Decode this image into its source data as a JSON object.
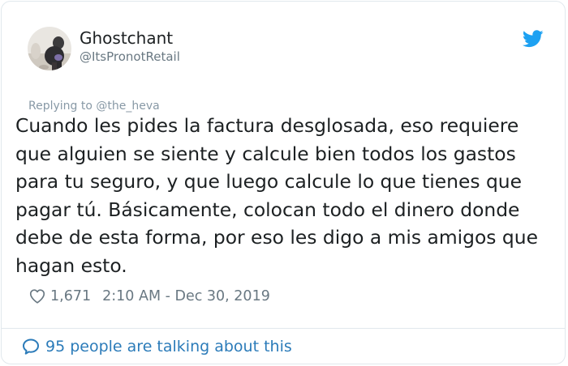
{
  "author": {
    "display_name": "Ghostchant",
    "handle": "@ItsPronotRetail"
  },
  "reply_context": "Replying to @the_heva",
  "tweet": {
    "lines": [
      "Cuando les pides la factura desglosada, eso requiere",
      "que alguien se siente y calcule bien todos los gastos",
      "para tu seguro, y que luego calcule lo que tienes que",
      "pagar tú. Básicamente, colocan todo el dinero donde",
      "debe de esta forma, por eso les digo a mis amigos que",
      "hagan esto."
    ]
  },
  "meta": {
    "likes": "1,671",
    "timestamp": "2:10 AM - Dec 30, 2019"
  },
  "footer": {
    "talking": "95 people are talking about this"
  },
  "icons": {
    "bird": "twitter-bird-icon",
    "heart": "heart-outline-icon",
    "bubble": "speech-bubble-icon"
  },
  "colors": {
    "brand_blue": "#1da1f2",
    "link_blue": "#2b7bb9",
    "secondary_text": "#697882",
    "border": "#e1e8ed"
  }
}
